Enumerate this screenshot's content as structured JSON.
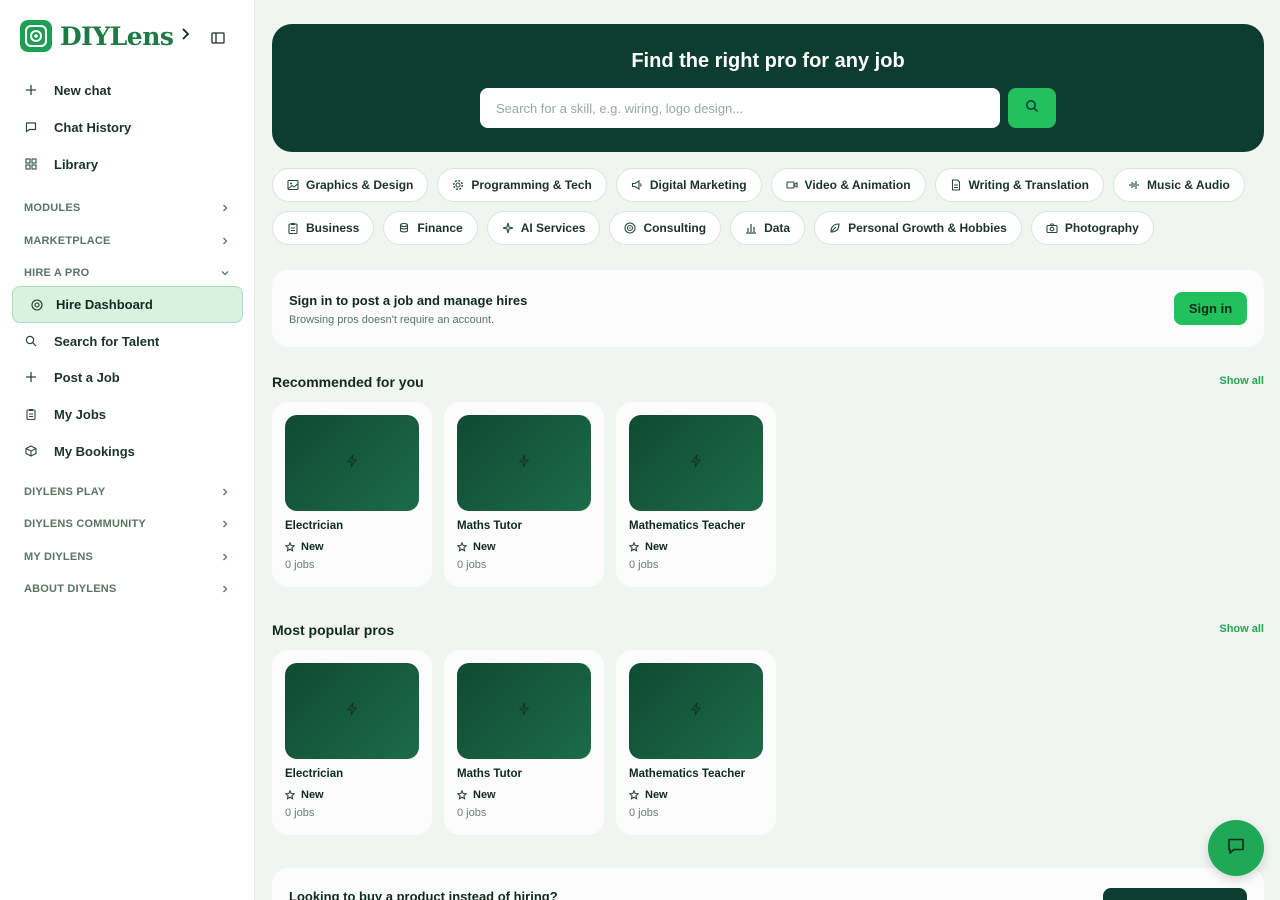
{
  "brand": {
    "name": "DIYLens"
  },
  "sidebar": {
    "top_items": [
      {
        "label": "New chat",
        "icon": "plus-icon"
      },
      {
        "label": "Chat History",
        "icon": "chat-bubble-icon"
      },
      {
        "label": "Library",
        "icon": "grid-icon"
      }
    ],
    "sections_before": [
      {
        "label": "MODULES"
      },
      {
        "label": "MARKETPLACE"
      }
    ],
    "hire_section": {
      "label": "HIRE A PRO",
      "expanded": true
    },
    "active_item": {
      "label": "Hire Dashboard",
      "icon": "target-icon"
    },
    "hire_items": [
      {
        "label": "Search for Talent",
        "icon": "search-icon"
      },
      {
        "label": "Post a Job",
        "icon": "plus-icon"
      },
      {
        "label": "My Jobs",
        "icon": "clipboard-icon"
      },
      {
        "label": "My Bookings",
        "icon": "box-icon"
      }
    ],
    "sections_after": [
      {
        "label": "DIYLENS PLAY"
      },
      {
        "label": "DIYLENS COMMUNITY"
      },
      {
        "label": "MY DIYLENS"
      },
      {
        "label": "ABOUT DIYLENS"
      }
    ]
  },
  "hero": {
    "title": "Find the right pro for any job",
    "search_placeholder": "Search for a skill, e.g. wiring, logo design..."
  },
  "categories": [
    {
      "label": "Graphics & Design",
      "icon": "image-icon"
    },
    {
      "label": "Programming & Tech",
      "icon": "gear-icon"
    },
    {
      "label": "Digital Marketing",
      "icon": "megaphone-icon"
    },
    {
      "label": "Video & Animation",
      "icon": "video-icon"
    },
    {
      "label": "Writing & Translation",
      "icon": "document-icon"
    },
    {
      "label": "Music & Audio",
      "icon": "audio-wave-icon"
    },
    {
      "label": "Business",
      "icon": "clipboard-icon"
    },
    {
      "label": "Finance",
      "icon": "coins-icon"
    },
    {
      "label": "AI Services",
      "icon": "sparkle-icon"
    },
    {
      "label": "Consulting",
      "icon": "target-icon"
    },
    {
      "label": "Data",
      "icon": "bar-chart-icon"
    },
    {
      "label": "Personal Growth & Hobbies",
      "icon": "leaf-icon"
    },
    {
      "label": "Photography",
      "icon": "camera-icon"
    }
  ],
  "signin": {
    "title": "Sign in to post a job and manage hires",
    "subtitle": "Browsing pros doesn't require an account.",
    "button": "Sign in"
  },
  "recommended": {
    "title": "Recommended for you",
    "show_all": "Show all",
    "cards": [
      {
        "name": "Electrician",
        "badge": "New",
        "jobs": "0 jobs"
      },
      {
        "name": "Maths Tutor",
        "badge": "New",
        "jobs": "0 jobs"
      },
      {
        "name": "Mathematics Teacher",
        "badge": "New",
        "jobs": "0 jobs"
      }
    ]
  },
  "popular": {
    "title": "Most popular pros",
    "show_all": "Show all",
    "cards": [
      {
        "name": "Electrician",
        "badge": "New",
        "jobs": "0 jobs"
      },
      {
        "name": "Maths Tutor",
        "badge": "New",
        "jobs": "0 jobs"
      },
      {
        "name": "Mathematics Teacher",
        "badge": "New",
        "jobs": "0 jobs"
      }
    ]
  },
  "bottom_card": {
    "title": "Looking to buy a product instead of hiring?"
  },
  "colors": {
    "hero_bg": "#0c3d2e",
    "accent": "#22c15e",
    "active_bg": "#d8f2e0"
  }
}
